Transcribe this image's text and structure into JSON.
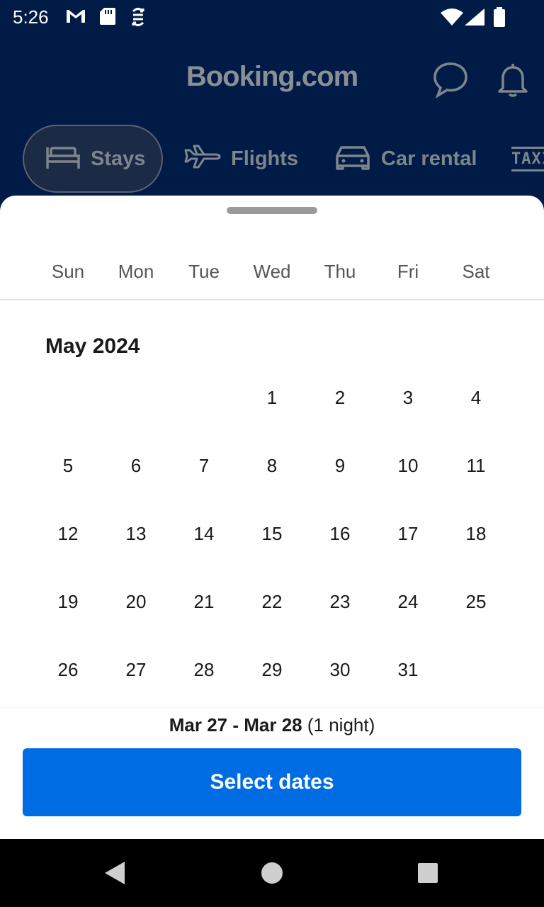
{
  "status_bar": {
    "time": "5:26",
    "icons": [
      "gmail-icon",
      "sd-card-icon",
      "sync-icon",
      "wifi-icon",
      "signal-icon",
      "battery-icon"
    ]
  },
  "header": {
    "logo": "Booking.com",
    "icons": [
      "chat-icon",
      "bell-icon"
    ],
    "tabs": [
      {
        "label": "Stays",
        "icon": "bed-icon",
        "active": true
      },
      {
        "label": "Flights",
        "icon": "plane-icon",
        "active": false
      },
      {
        "label": "Car rental",
        "icon": "car-icon",
        "active": false
      },
      {
        "label": "TAXI",
        "icon": "taxi-icon",
        "active": false
      }
    ]
  },
  "calendar": {
    "weekdays": [
      "Sun",
      "Mon",
      "Tue",
      "Wed",
      "Thu",
      "Fri",
      "Sat"
    ],
    "month_title": "May 2024",
    "weeks": [
      [
        "",
        "",
        "",
        "1",
        "2",
        "3",
        "4"
      ],
      [
        "5",
        "6",
        "7",
        "8",
        "9",
        "10",
        "11"
      ],
      [
        "12",
        "13",
        "14",
        "15",
        "16",
        "17",
        "18"
      ],
      [
        "19",
        "20",
        "21",
        "22",
        "23",
        "24",
        "25"
      ],
      [
        "26",
        "27",
        "28",
        "29",
        "30",
        "31",
        ""
      ]
    ]
  },
  "footer": {
    "date_range": "Mar 27 - Mar 28",
    "nights": "(1 night)",
    "button_label": "Select dates"
  },
  "colors": {
    "header_bg": "#001b45",
    "button_bg": "#006ce4",
    "muted_header_text": "#7f858d"
  },
  "nav_bar": {
    "icons": [
      "back-icon",
      "home-icon",
      "recents-icon"
    ]
  }
}
